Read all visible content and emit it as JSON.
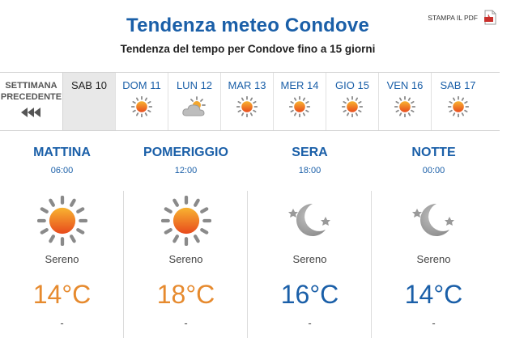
{
  "header": {
    "title": "Tendenza meteo Condove",
    "subtitle": "Tendenza del tempo per Condove fino a 15 giorni",
    "pdf_label": "STAMPA IL PDF"
  },
  "prev_week": {
    "label": "SETTIMANA\nPRECEDENTE",
    "icon": "triple-left-arrow-icon"
  },
  "days": [
    {
      "label": "SAB 10",
      "icon": "",
      "active": true
    },
    {
      "label": "DOM 11",
      "icon": "sun-icon"
    },
    {
      "label": "LUN 12",
      "icon": "cloud-sun-icon"
    },
    {
      "label": "MAR 13",
      "icon": "sun-icon"
    },
    {
      "label": "MER 14",
      "icon": "sun-icon"
    },
    {
      "label": "GIO 15",
      "icon": "sun-icon"
    },
    {
      "label": "VEN 16",
      "icon": "sun-icon"
    },
    {
      "label": "SAB 17",
      "icon": "sun-icon"
    }
  ],
  "periods": [
    {
      "name": "MATTINA",
      "time": "06:00",
      "icon": "sun-icon",
      "condition": "Sereno",
      "temp": "14°C",
      "tone": "warm",
      "extra": "-"
    },
    {
      "name": "POMERIGGIO",
      "time": "12:00",
      "icon": "sun-icon",
      "condition": "Sereno",
      "temp": "18°C",
      "tone": "warm",
      "extra": "-"
    },
    {
      "name": "SERA",
      "time": "18:00",
      "icon": "moon-stars-icon",
      "condition": "Sereno",
      "temp": "16°C",
      "tone": "cool",
      "extra": "-"
    },
    {
      "name": "NOTTE",
      "time": "00:00",
      "icon": "moon-stars-icon",
      "condition": "Sereno",
      "temp": "14°C",
      "tone": "cool",
      "extra": "-"
    }
  ],
  "colors": {
    "accent": "#1a5fa8",
    "warm": "#e68a2e",
    "active_bg": "#e8e8e8"
  }
}
